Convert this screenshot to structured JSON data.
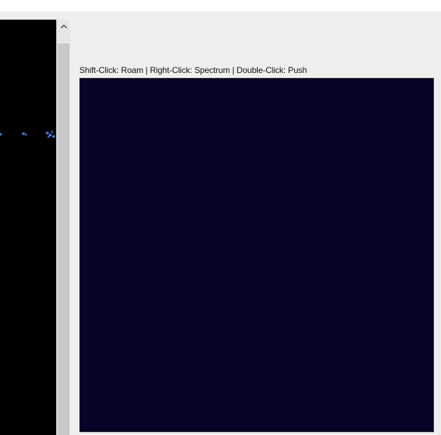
{
  "toolbar": {
    "hint_text": "Shift-Click: Roam | Right-Click: Spectrum | Double-Click: Push"
  },
  "scrollbar": {
    "up_arrow_icon": "chevron-up-icon"
  },
  "colors": {
    "window_bg": "#efefef",
    "left_panel_bg": "#000000",
    "simulation_bg": "#050528",
    "particle": "#4a8cff"
  }
}
